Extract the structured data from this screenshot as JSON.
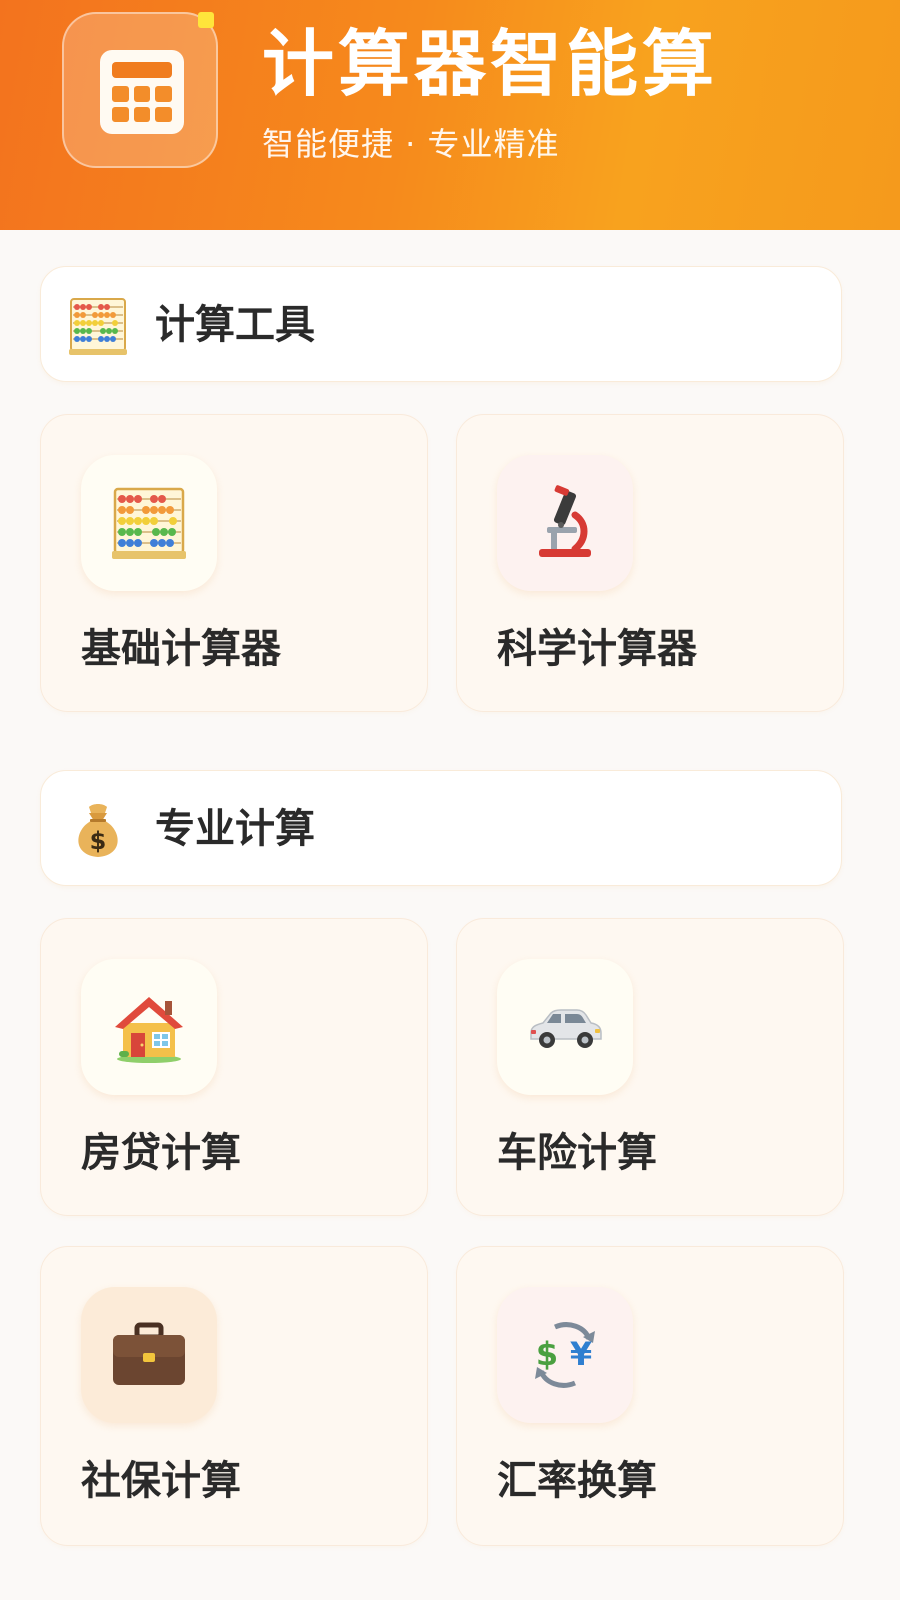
{
  "header": {
    "title": "计算器智能算",
    "subtitle": "智能便捷 · 专业精准",
    "logo_icon": "calculator-icon"
  },
  "sections": [
    {
      "label": "计算工具",
      "icon": "abacus-icon",
      "items": [
        {
          "label": "基础计算器",
          "icon": "abacus-icon"
        },
        {
          "label": "科学计算器",
          "icon": "microscope-icon"
        }
      ]
    },
    {
      "label": "专业计算",
      "icon": "money-bag-icon",
      "items": [
        {
          "label": "房贷计算",
          "icon": "house-icon"
        },
        {
          "label": "车险计算",
          "icon": "car-icon"
        },
        {
          "label": "社保计算",
          "icon": "briefcase-icon"
        },
        {
          "label": "汇率换算",
          "icon": "currency-exchange-icon"
        }
      ]
    }
  ],
  "colors": {
    "header_start": "#f3731e",
    "header_end": "#f8a21e",
    "card_bg": "#fef8f1",
    "text": "#2a2a2a"
  }
}
